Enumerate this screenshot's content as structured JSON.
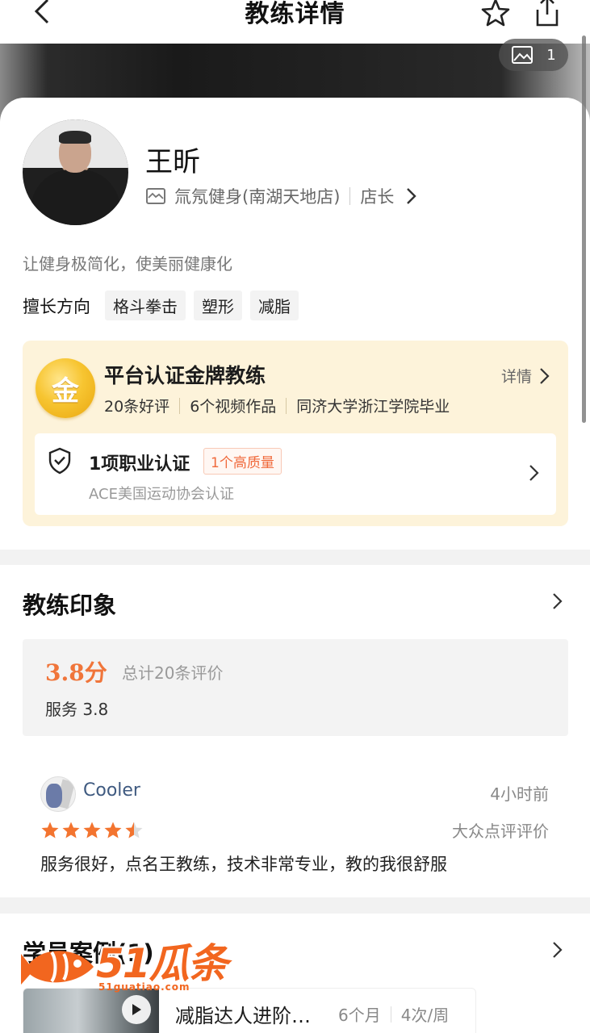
{
  "nav": {
    "title": "教练详情"
  },
  "hero": {
    "photo_count": "1"
  },
  "coach": {
    "name": "王昕",
    "store": "氚氖健身(南湖天地店)",
    "role": "店长",
    "motto": "让健身极简化，使美丽健康化",
    "skills_label": "擅长方向",
    "skills": [
      "格斗拳击",
      "塑形",
      "减脂"
    ]
  },
  "gold": {
    "medal_char": "金",
    "title": "平台认证金牌教练",
    "detail": "详情",
    "stats": [
      "20条好评",
      "6个视频作品",
      "同济大学浙江学院毕业"
    ],
    "cert_title": "1项职业认证",
    "cert_badge": "1个高质量",
    "cert_sub": "ACE美国运动协会认证"
  },
  "impression": {
    "title": "教练印象",
    "score": "3.8分",
    "total": "总计20条评价",
    "service": "服务 3.8"
  },
  "review": {
    "user": "Cooler",
    "time": "4小时前",
    "rating": 4.5,
    "source": "大众点评评价",
    "text": "服务很好，点名王教练，技术非常专业，教的我很舒服"
  },
  "cases": {
    "title": "学员案例(1)",
    "item_name": "减脂达人进阶…",
    "duration": "6个月",
    "frequency": "4次/周"
  },
  "watermark": {
    "text": "51瓜条",
    "sub": "51guatiao.com"
  },
  "colors": {
    "accent": "#f0753a",
    "gold_bg": "#fdf3da",
    "badge": "#f06a3c"
  }
}
